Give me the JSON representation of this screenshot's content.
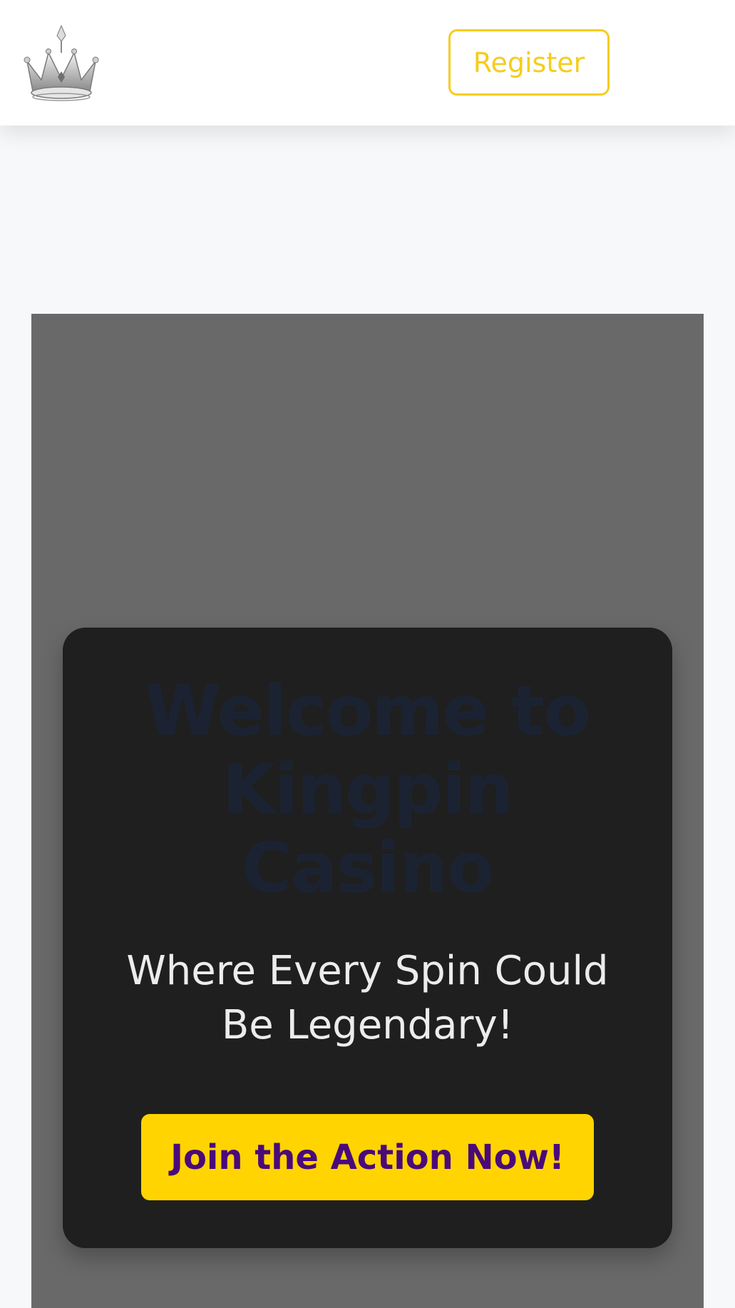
{
  "header": {
    "register_label": "Register"
  },
  "hero": {
    "title_lines": [
      "Welcome to",
      "Kingpin",
      "Casino"
    ],
    "subtitle_lines": [
      "Where Every Spin Could",
      "Be Legendary!"
    ],
    "cta_label": "Join the Action Now!"
  },
  "icons": {
    "logo": "crown-logo-icon"
  },
  "colors": {
    "accent_yellow": "#f5cd1c",
    "cta_yellow": "#ffd400",
    "cta_text_purple": "#4a0a7a",
    "hero_bg_gray": "#696969",
    "card_bg": "#1f1f1f",
    "title_navy": "#1b2333"
  }
}
